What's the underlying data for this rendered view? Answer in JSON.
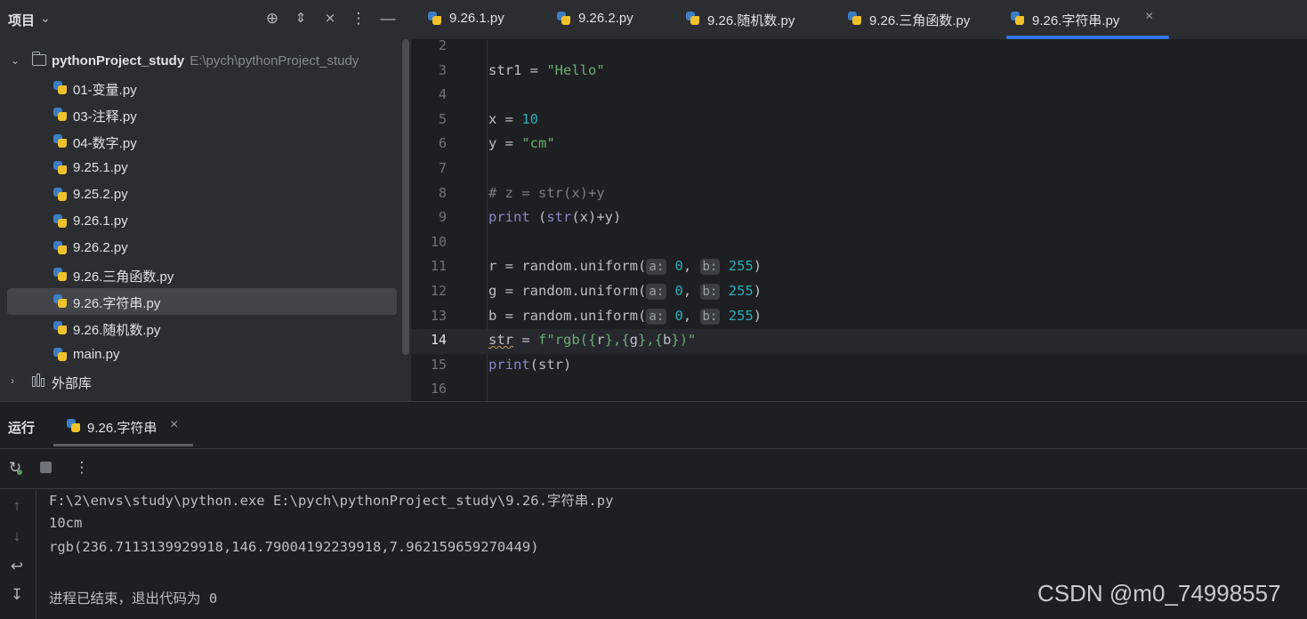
{
  "project": {
    "title": "项目",
    "root": {
      "name": "pythonProject_study",
      "path": "E:\\pych\\pythonProject_study"
    },
    "files": [
      "01-变量.py",
      "03-注释.py",
      "04-数字.py",
      "9.25.1.py",
      "9.25.2.py",
      "9.26.1.py",
      "9.26.2.py",
      "9.26.三角函数.py",
      "9.26.字符串.py",
      "9.26.随机数.py",
      "main.py"
    ],
    "selected_file": "9.26.字符串.py",
    "external_libs": "外部库",
    "header_icons": [
      "target-icon",
      "expand-collapse-icon",
      "collapse-all-icon",
      "more-icon",
      "minimize-icon"
    ]
  },
  "editor": {
    "tabs": [
      {
        "label": "9.26.1.py",
        "active": false
      },
      {
        "label": "9.26.2.py",
        "active": false
      },
      {
        "label": "9.26.随机数.py",
        "active": false
      },
      {
        "label": "9.26.三角函数.py",
        "active": false
      },
      {
        "label": "9.26.字符串.py",
        "active": true
      }
    ],
    "current_line": 14,
    "lines": [
      {
        "n": "2",
        "tokens": []
      },
      {
        "n": "3",
        "tokens": [
          [
            "str1 = ",
            ""
          ],
          [
            "\"Hello\"",
            "str"
          ]
        ]
      },
      {
        "n": "4",
        "tokens": []
      },
      {
        "n": "5",
        "tokens": [
          [
            "x = ",
            ""
          ],
          [
            "10",
            "num"
          ]
        ]
      },
      {
        "n": "6",
        "tokens": [
          [
            "y = ",
            ""
          ],
          [
            "\"cm\"",
            "str"
          ]
        ]
      },
      {
        "n": "7",
        "tokens": []
      },
      {
        "n": "8",
        "tokens": [
          [
            "# z = str(x)+y",
            "cmt"
          ]
        ]
      },
      {
        "n": "9",
        "tokens": [
          [
            "print",
            "fn"
          ],
          [
            " (",
            ""
          ],
          [
            "str",
            "fn"
          ],
          [
            "(x)+y)",
            ""
          ]
        ]
      },
      {
        "n": "10",
        "tokens": []
      },
      {
        "n": "11",
        "tokens": [
          [
            "r = random.uniform(",
            ""
          ],
          [
            "a:",
            "hint"
          ],
          [
            " ",
            ""
          ],
          [
            "0",
            "num"
          ],
          [
            ", ",
            ""
          ],
          [
            "b:",
            "hint"
          ],
          [
            " ",
            ""
          ],
          [
            "255",
            "num"
          ],
          [
            ")",
            ""
          ]
        ]
      },
      {
        "n": "12",
        "tokens": [
          [
            "g = random.uniform(",
            ""
          ],
          [
            "a:",
            "hint"
          ],
          [
            " ",
            ""
          ],
          [
            "0",
            "num"
          ],
          [
            ", ",
            ""
          ],
          [
            "b:",
            "hint"
          ],
          [
            " ",
            ""
          ],
          [
            "255",
            "num"
          ],
          [
            ")",
            ""
          ]
        ]
      },
      {
        "n": "13",
        "tokens": [
          [
            "b = random.uniform(",
            ""
          ],
          [
            "a:",
            "hint"
          ],
          [
            " ",
            ""
          ],
          [
            "0",
            "num"
          ],
          [
            ", ",
            ""
          ],
          [
            "b:",
            "hint"
          ],
          [
            " ",
            ""
          ],
          [
            "255",
            "num"
          ],
          [
            ")",
            ""
          ]
        ]
      },
      {
        "n": "14",
        "tokens": [
          [
            "str",
            "squig"
          ],
          [
            " = ",
            ""
          ],
          [
            "f\"rgb({",
            "str"
          ],
          [
            "r",
            ""
          ],
          [
            "},{",
            "str"
          ],
          [
            "g",
            ""
          ],
          [
            "},{",
            "str"
          ],
          [
            "b",
            ""
          ],
          [
            "})\"",
            "str"
          ]
        ]
      },
      {
        "n": "15",
        "tokens": [
          [
            "print",
            "fn"
          ],
          [
            "(str)",
            ""
          ]
        ]
      },
      {
        "n": "16",
        "tokens": []
      }
    ]
  },
  "run": {
    "title": "运行",
    "tab_label": "9.26.字符串",
    "output": [
      "F:\\2\\envs\\study\\python.exe E:\\pych\\pythonProject_study\\9.26.字符串.py",
      "10cm",
      "rgb(236.7113139929918,146.79004192239918,7.962159659270449)",
      "",
      "进程已结束，退出代码为 0"
    ]
  },
  "watermark": "CSDN @m0_74998557"
}
